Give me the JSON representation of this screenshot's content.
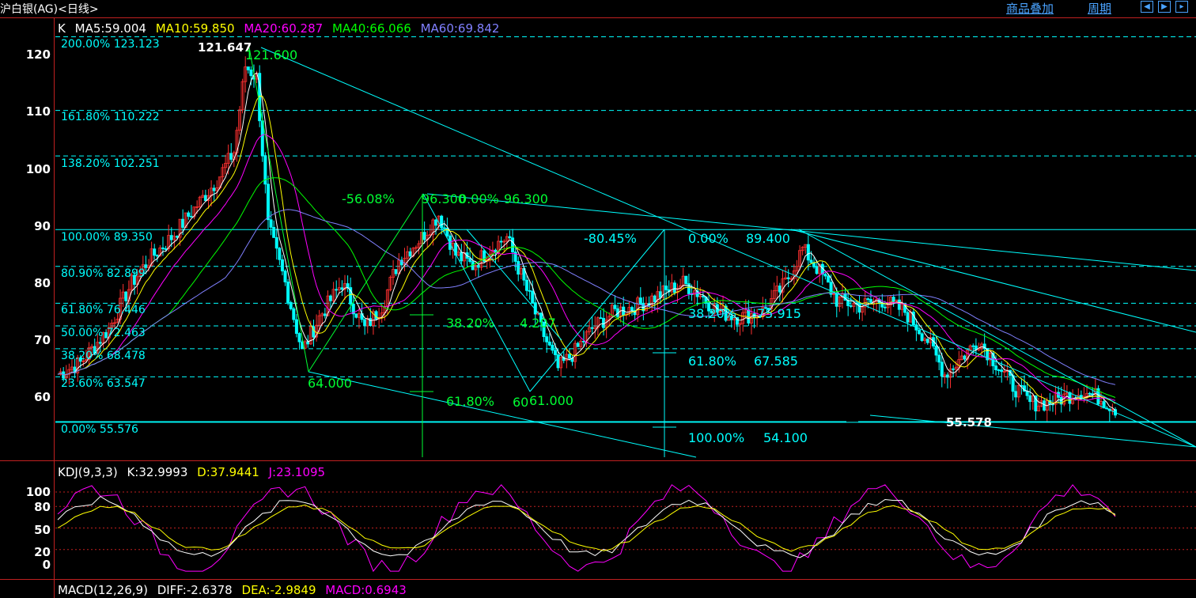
{
  "header": {
    "title": "沪白银(AG)<日线>",
    "links": [
      "商品叠加",
      "周期"
    ],
    "nav_buttons": [
      "left-arrow",
      "right-arrow",
      "more-arrow"
    ]
  },
  "main_legend": [
    {
      "text": "K",
      "color": "#ffffff"
    },
    {
      "text": "MA5:59.004",
      "color": "#ffffff"
    },
    {
      "text": "MA10:59.850",
      "color": "#ffff00"
    },
    {
      "text": "MA20:60.287",
      "color": "#ff00ff"
    },
    {
      "text": "MA40:66.066",
      "color": "#00ff00"
    },
    {
      "text": "MA60:69.842",
      "color": "#8080ff"
    }
  ],
  "y_ticks": [
    {
      "label": "120",
      "value": 120
    },
    {
      "label": "110",
      "value": 110
    },
    {
      "label": "100",
      "value": 100
    },
    {
      "label": "90",
      "value": 90
    },
    {
      "label": "80",
      "value": 80
    },
    {
      "label": "70",
      "value": 70
    },
    {
      "label": "60",
      "value": 60
    }
  ],
  "fib_levels": [
    {
      "label": "200.00% 123.123",
      "value": 123.123
    },
    {
      "label": "161.80% 110.222",
      "value": 110.222
    },
    {
      "label": "138.20% 102.251",
      "value": 102.251
    },
    {
      "label": "100.00% 89.350",
      "value": 89.35
    },
    {
      "label": "80.90% 82.899",
      "value": 82.899
    },
    {
      "label": "61.80% 76.446",
      "value": 76.446
    },
    {
      "label": "50.00% 72.463",
      "value": 72.463
    },
    {
      "label": "38.20% 68.478",
      "value": 68.478
    },
    {
      "label": "23.60% 63.547",
      "value": 63.547
    },
    {
      "label": "0.00% 55.576",
      "value": 55.576
    }
  ],
  "annotations": {
    "high_price": "121.647",
    "high_label": "121.600",
    "low_price": "55.578",
    "a64": "64.000",
    "a61": "61.000",
    "a600": "60",
    "pct_neg56": "-56.08%",
    "p963a": "96.300",
    "p0": "0.00%",
    "p963b": "96.300",
    "pct_neg80": "-80.45%",
    "p00b": "0.00%",
    "p894": "89.400",
    "p382a": "38.20%",
    "p207": "4.207",
    "p618a": "61.80%",
    "p382b": "38.20%",
    "p75915": "75.915",
    "p618b": "61.80%",
    "p67585": "67.585",
    "p100": "100.00%",
    "p541": "54.100"
  },
  "kdj_legend": [
    {
      "text": "KDJ(9,3,3)",
      "color": "#ffffff"
    },
    {
      "text": "K:32.9993",
      "color": "#ffffff"
    },
    {
      "text": "D:37.9441",
      "color": "#ffff00"
    },
    {
      "text": "J:23.1095",
      "color": "#ff00ff"
    }
  ],
  "kdj_ticks": [
    {
      "label": "100",
      "value": 100
    },
    {
      "label": "80",
      "value": 80
    },
    {
      "label": "50",
      "value": 50
    },
    {
      "label": "20",
      "value": 20
    },
    {
      "label": "0",
      "value": 0
    }
  ],
  "macd_legend": [
    {
      "text": "MACD(12,26,9)",
      "color": "#ffffff"
    },
    {
      "text": "DIFF:-2.6378",
      "color": "#ffffff"
    },
    {
      "text": "DEA:-2.9849",
      "color": "#ffff00"
    },
    {
      "text": "MACD:0.6943",
      "color": "#ff00ff"
    }
  ],
  "colors": {
    "up": "#ff3030",
    "down": "#00ffff",
    "grid": "#c02020",
    "fib": "#00ffff",
    "annotation": "#00ff33"
  }
}
